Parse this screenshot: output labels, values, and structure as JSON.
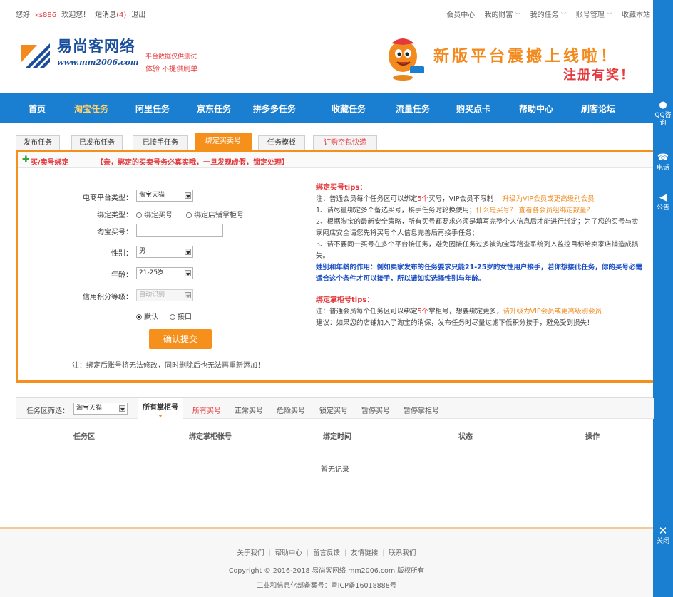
{
  "topbar": {
    "greeting": "您好",
    "username": "ks886",
    "welcome": "欢迎您！",
    "messages_label": "短消息",
    "messages_count": "(4)",
    "logout": "退出",
    "right_links": [
      "会员中心",
      "我的财富",
      "我的任务",
      "账号管理",
      "收藏本站"
    ]
  },
  "header": {
    "brand_name": "易尚客网络",
    "brand_url": "www.mm2006.com",
    "note1": "平台数据仅供测试",
    "note2": "体验 不提供刷单",
    "promo_title": "新版平台震撼上线啦！",
    "promo_sub": "注册有奖！"
  },
  "nav": {
    "items": [
      "首页",
      "淘宝任务",
      "阿里任务",
      "京东任务",
      "拼多多任务",
      "收藏任务",
      "流量任务",
      "购买点卡",
      "帮助中心",
      "刷客论坛"
    ],
    "active_index": 1
  },
  "rail": {
    "qq": "QQ咨询",
    "phone": "电话",
    "notice": "公告",
    "close": "关闭"
  },
  "tabs": [
    "发布任务",
    "已发布任务",
    "已接手任务",
    "绑定买卖号",
    "任务模板",
    "订购空包快递"
  ],
  "panel": {
    "title": "买/卖号绑定",
    "warning": "【亲，绑定的买卖号务必真实哦，一旦发现虚假，锁定处理】",
    "form": {
      "platform_label": "电商平台类型：",
      "platform_value": "淘宝天猫",
      "bind_type_label": "绑定类型：",
      "bind_type_opt1": "绑定买号",
      "bind_type_opt2": "绑定店铺掌柜号",
      "account_label": "淘宝买号：",
      "gender_label": "性别：",
      "gender_value": "男",
      "age_label": "年龄：",
      "age_value": "21-25岁",
      "credit_label": "信用积分等级：",
      "credit_value": "自动识别",
      "mode_opt1": "默认",
      "mode_opt2": "接口",
      "submit": "确认提交",
      "note": "注：绑定后账号将无法修改，同时删除后也无法再重新添加！"
    },
    "tips": {
      "buyer_title": "绑定买号tips：",
      "buyer_l1a": "注：普通会员每个任务区可以绑定",
      "buyer_l1b": "5个",
      "buyer_l1c": "买号，VIP会员不限制！",
      "buyer_l1d": "升级为VIP会员或更高级别会员",
      "buyer_l2a": "1、请尽量绑定多个备选买号，接手任务时轮换使用；",
      "buyer_l2b": "什么是买号？",
      "buyer_l2c": "查看各会员组绑定数量？",
      "buyer_l3": "2、根据淘宝的最新安全策略，所有买号都要求必须是填写完整个人信息后才能进行绑定；为了您的买号与卖家网店安全请您先将买号个人信息完善后再接手任务；",
      "buyer_l4": "3、请不要同一买号在多个平台接任务，避免因接任务过多被淘宝等稽查系统列入监控目标给卖家店铺造成损失。",
      "buyer_l5": "姓别和年龄的作用：例如卖家发布的任务要求只能21-25岁的女性用户接手，若你想接此任务，你的买号必需适合这个条件才可以接手，所以请如实选择性别与年龄。",
      "seller_title": "绑定掌柜号tips：",
      "seller_l1a": "注：普通会员每个任务区可以绑定",
      "seller_l1b": "5个",
      "seller_l1c": "掌柜号，想要绑定更多，",
      "seller_l1d": "请升级为VIP会员或更高级别会员",
      "seller_l2": "建议：如果您的店铺加入了淘宝的消保，发布任务时尽量过滤下低积分接手，避免受到损失！"
    }
  },
  "task_area": {
    "filter_label": "任务区筛选：",
    "filter_value": "淘宝天猫",
    "links": [
      "所有掌柜号",
      "所有买号",
      "正常买号",
      "危险买号",
      "锁定买号",
      "暂停买号",
      "暂停掌柜号"
    ],
    "active_index": 0,
    "columns": [
      "任务区",
      "绑定掌柜帐号",
      "绑定时间",
      "状态",
      "操作"
    ],
    "empty_text": "暂无记录"
  },
  "footer": {
    "links": [
      "关于我们",
      "帮助中心",
      "留言反馈",
      "友情链接",
      "联系我们"
    ],
    "copyright": "Copyright © 2016-2018 易尚客网络 mm2006.com 版权所有",
    "icp": "工业和信息化部备案号：粤ICP备16018888号"
  },
  "colors": {
    "nav_blue": "#1b7fd1",
    "accent_orange": "#f5901d",
    "alert_red": "#e4393c",
    "brand_blue": "#1b4f9c"
  }
}
